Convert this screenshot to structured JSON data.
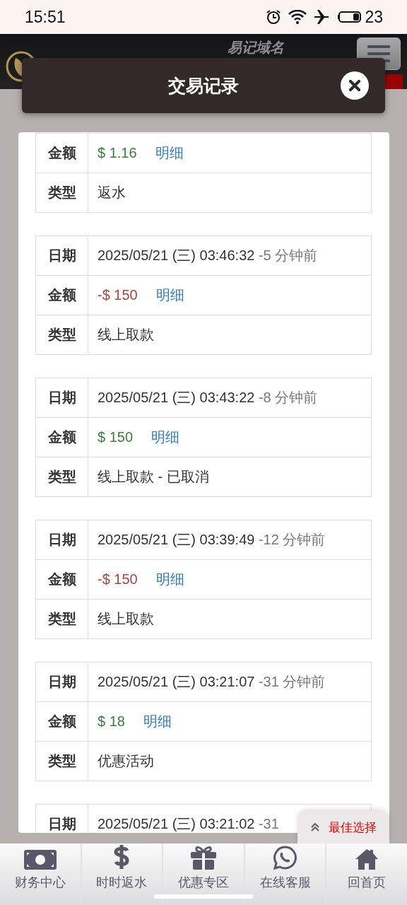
{
  "status_bar": {
    "time": "15:51",
    "battery": "23"
  },
  "site_header": {
    "tagline": "易记域名"
  },
  "modal": {
    "title": "交易记录"
  },
  "records": [
    {
      "rows": [
        {
          "kind": "amount_in",
          "label": "金额",
          "value": "$ 1.16",
          "link": "明细"
        },
        {
          "kind": "type",
          "label": "类型",
          "value": "返水"
        }
      ]
    },
    {
      "rows": [
        {
          "kind": "date",
          "label": "日期",
          "value": "2025/05/21 (三) 03:46:32",
          "ago": "-5 分钟前"
        },
        {
          "kind": "amount_out",
          "label": "金额",
          "value": "-$ 150",
          "link": "明细"
        },
        {
          "kind": "type",
          "label": "类型",
          "value": "线上取款"
        }
      ]
    },
    {
      "rows": [
        {
          "kind": "date",
          "label": "日期",
          "value": "2025/05/21 (三) 03:43:22",
          "ago": "-8 分钟前"
        },
        {
          "kind": "amount_in",
          "label": "金额",
          "value": "$ 150",
          "link": "明细"
        },
        {
          "kind": "type",
          "label": "类型",
          "value": "线上取款 - 已取消"
        }
      ]
    },
    {
      "rows": [
        {
          "kind": "date",
          "label": "日期",
          "value": "2025/05/21 (三) 03:39:49",
          "ago": "-12 分钟前"
        },
        {
          "kind": "amount_out",
          "label": "金额",
          "value": "-$ 150",
          "link": "明细"
        },
        {
          "kind": "type",
          "label": "类型",
          "value": "线上取款"
        }
      ]
    },
    {
      "rows": [
        {
          "kind": "date",
          "label": "日期",
          "value": "2025/05/21 (三) 03:21:07",
          "ago": "-31 分钟前"
        },
        {
          "kind": "amount_in",
          "label": "金额",
          "value": "$ 18",
          "link": "明细"
        },
        {
          "kind": "type",
          "label": "类型",
          "value": "优惠活动"
        }
      ]
    },
    {
      "rows": [
        {
          "kind": "date",
          "label": "日期",
          "value": "2025/05/21 (三) 03:21:02",
          "ago": "-31"
        }
      ]
    }
  ],
  "float_button": {
    "label": "最佳选择"
  },
  "bottom_nav": [
    {
      "label": "财务中心"
    },
    {
      "label": "时时返水"
    },
    {
      "label": "优惠专区"
    },
    {
      "label": "在线客服"
    },
    {
      "label": "回首页"
    }
  ]
}
